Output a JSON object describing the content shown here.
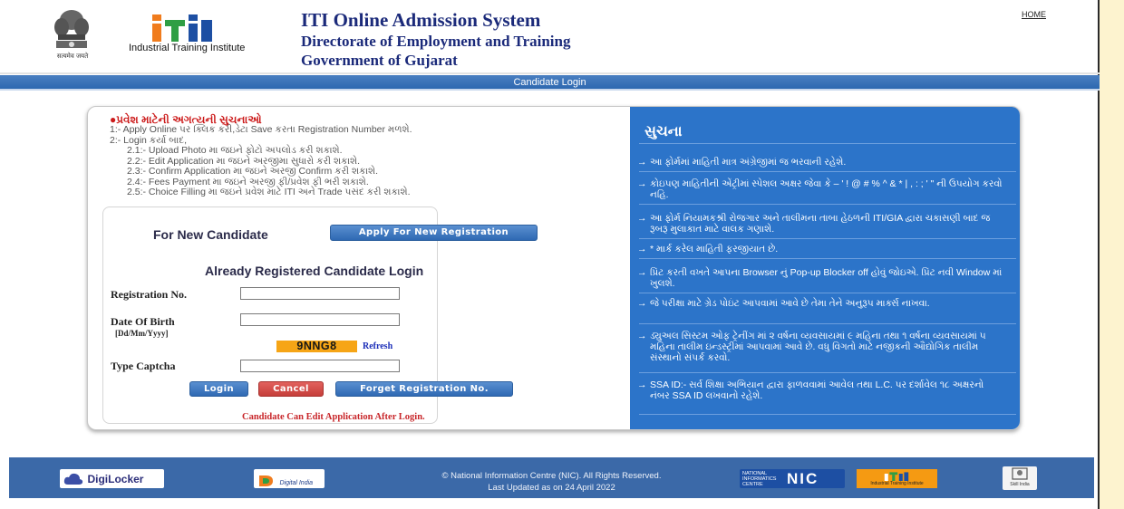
{
  "header": {
    "emblem_caption": "सत्यमेव जयते",
    "logo_caption": "Industrial Training Institute",
    "title": "ITI Online Admission System",
    "subtitle1": "Directorate of Employment and Training",
    "subtitle2": "Government of Gujarat",
    "home_link": "HOME"
  },
  "banner": {
    "title": "Candidate Login"
  },
  "notice": {
    "title": "પ્રવેશ માટેની અગત્યની સુચનાઓ",
    "items": [
      "1:- Apply Online પર ક્લિક કરી,ડેટા Save કરતા Registration Number મળશે.",
      "2:- Login કર્યા બાદ,",
      "2.1:- Upload Photo મા જઇને ફોટો અપલોડ કરી શકાશે.",
      "2.2:- Edit Application મા જઇને અરજીમા સુધારો કરી શકાશે.",
      "2.3:- Confirm Application મા જઇને અરજી Confirm કરી શકાશે.",
      "2.4:- Fees Payment મા જઇને અરજી ફી/પ્રવેશ ફી ભરી શકાશે.",
      "2.5:- Choice Filling મા જઇને પ્રવેશ માટે ITI અને Trade પસંદ કરી શકાશે."
    ]
  },
  "login": {
    "new_candidate_label": "For New Candidate",
    "apply_button": "Apply For New Registration",
    "already_title": "Already Registered Candidate Login",
    "reg_label": "Registration No.",
    "reg_value": "",
    "dob_label": "Date Of Birth",
    "dob_format": "[Dd/Mm/Yyyy]",
    "dob_value": "",
    "captcha_text": "9NNG8",
    "refresh_label": "Refresh",
    "captcha_label": "Type Captcha",
    "captcha_value": "",
    "login_button": "Login",
    "cancel_button": "Cancel",
    "forget_button": "Forget Registration No.",
    "edit_note": "Candidate Can Edit Application After Login."
  },
  "instructions": {
    "title": "સુચના",
    "items": [
      "આ ફોર્મમાં માહિતી માત્ર અંગ્રેજીમાં જ ભરવાની રહેશે.",
      "કોઇપણ માહિતીની એંટ્રીમાં સ્પેશલ અક્ષર જેવા કે – ' ! @ # % ^ & * | , : ; ' \" ની ઉપયોગ કરવો નહિ.",
      "આ ફોર્મ નિયામકશ્રી રોજગાર અને તાલીમના તાબા હેઠળની ITI/GIA દ્વારા ચકાસણી બાદ જ રૂબરૂ મુલાકાત માટે વાલક ગણાશે.",
      "* માર્ક કરેલ માહિતી ફરજીયાત છે.",
      "પ્રિંટ કરતી વખતે આપના Browser નું Pop-up Blocker off હોવું જોઇએ. પ્રિંટ નવી Window માં ખુલશે.",
      "જે પરીક્ષા માટે ગ્રેડ પોઇંટ આપવામાં આવે છે તેમા તેને અનુરૂપ માર્ક્સ નાખવા.",
      "ડ્યુઅલ સિસ્ટમ ઓફ ટ્રેનીંગ માં ૨ વર્ષના વ્યવસાયમાં ૯ મહિના તથા ૧ વર્ષના વ્યવસાયમાં ૫ મહિના તાલીમ ઇન્ડસ્ટ્રીમાં આપવામાં આવે છે. વધુ વિગતો માટે નજીકની ઔદ્યોગિક તાલીમ સંસ્થાનો સંપર્ક કરવો.",
      "SSA ID:- સર્વ શિક્ષા અભિયાન દ્વારા ફાળવવામાં આવેલ તથા L.C. પર દર્શાવેલ ૧૮ અક્ષરનો નંબર SSA ID લખવાનો રહેશે."
    ]
  },
  "footer": {
    "digilocker": "DigiLocker",
    "digital_india": "Digital India",
    "copyright": "© National Information Centre (NIC). All Rights Reserved.",
    "updated": "Last Updated as on 24 April 2022",
    "nic_small": "NATIONAL INFORMATICS CENTRE",
    "nic": "NIC",
    "iti_caption": "Industrial Training Institute",
    "skill_india": "Skill India"
  },
  "colors": {
    "title_blue": "#1b2a7a",
    "banner_blue": "#2d68b0",
    "panel_blue": "#2c74c9",
    "captcha_bg": "#f6a516",
    "alert_red": "#c8262a",
    "footer_blue": "#3b69a8"
  }
}
